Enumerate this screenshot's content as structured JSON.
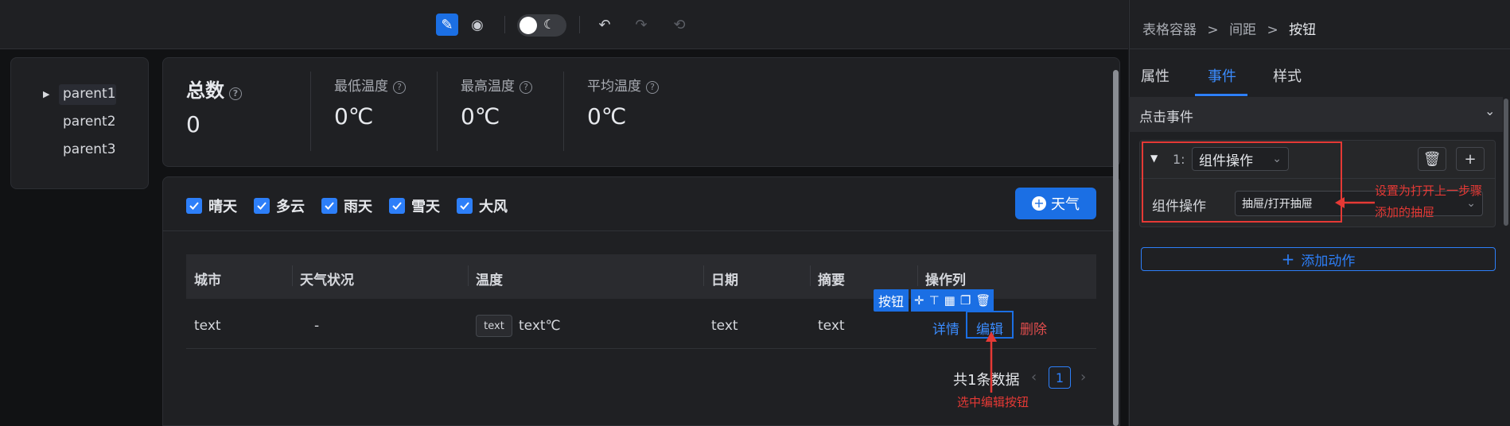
{
  "breadcrumb": [
    "表格容器",
    "间距",
    "按钮"
  ],
  "panel": {
    "tabs": [
      "属性",
      "事件",
      "样式"
    ],
    "active_tab": "事件",
    "section_title": "点击事件",
    "action_index": "1:",
    "action_type": "组件操作",
    "field_label": "组件操作",
    "field_value": "抽屉/打开抽屉",
    "add_action": "添加动作"
  },
  "tree": [
    "parent1",
    "parent2",
    "parent3"
  ],
  "stats": [
    {
      "label": "总数",
      "value": "0"
    },
    {
      "label": "最低温度",
      "value": "0℃"
    },
    {
      "label": "最高温度",
      "value": "0℃"
    },
    {
      "label": "平均温度",
      "value": "0℃"
    }
  ],
  "filters": [
    "晴天",
    "多云",
    "雨天",
    "雪天",
    "大风"
  ],
  "add_button": "天气",
  "table": {
    "headers": [
      "城市",
      "天气状况",
      "温度",
      "日期",
      "摘要",
      "操作列"
    ],
    "row": {
      "city": "text",
      "status": "-",
      "tag": "text",
      "temp": "text℃",
      "date": "text",
      "summary": "text"
    },
    "actions": [
      "详情",
      "编辑",
      "删除"
    ]
  },
  "selection_label": "按钮",
  "pagination": {
    "summary": "共1条数据",
    "page": "1"
  },
  "annotations": {
    "select_edit": "选中编辑按钮",
    "panel_note_1": "设置为打开上一步骤",
    "panel_note_2": "添加的抽屉"
  },
  "colors": {
    "accent": "#1b6fe4",
    "annotation": "#e53935",
    "danger": "#e04d4d"
  }
}
